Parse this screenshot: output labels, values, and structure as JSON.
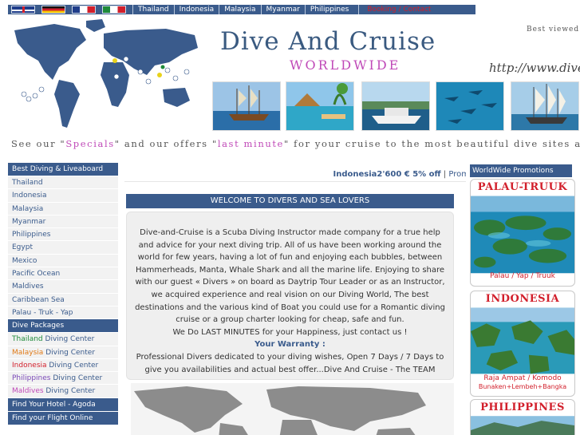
{
  "colors": {
    "nav": "#3a5b8c",
    "accent": "#c04ab8",
    "alert": "#d21f2b",
    "panel": "#efefef"
  },
  "topnav": {
    "flags": [
      "uk-flag-icon",
      "germany-flag-icon",
      "france-flag-icon",
      "italy-flag-icon"
    ],
    "links": [
      "Thailand",
      "Indonesia",
      "Malaysia",
      "Myanmar",
      "Philippines"
    ],
    "booking": "Booking / Contact"
  },
  "banner": {
    "title": "Dive And Cruise",
    "subtitle": "WORLDWIDE",
    "best_viewed": "Best viewed",
    "url": "http://www.dive-",
    "tagline_1": "See our \"",
    "tagline_specials": "Specials",
    "tagline_2": "\" and our offers \"",
    "tagline_last": "last minute",
    "tagline_3": "\" for your cruise to the most beautiful dive sites aro"
  },
  "sidebar": {
    "head1": "Best Diving & Liveaboard",
    "destinations": [
      "Thailand",
      "Indonesia",
      "Malaysia",
      "Myanmar",
      "Philippines",
      "Egypt",
      "Mexico",
      "Pacific Ocean",
      "Maldives",
      "Caribbean Sea",
      "Palau - Truk - Yap"
    ],
    "head2": "Dive Packages",
    "packages": [
      {
        "country": "Thailand",
        "rest": " Diving Center"
      },
      {
        "country": "Malaysia",
        "rest": " Diving Center"
      },
      {
        "country": "Indonesia",
        "rest": " Diving Center"
      },
      {
        "country": "Philippines",
        "rest": " Diving Center"
      },
      {
        "country": "Maldives",
        "rest": " Diving Center"
      }
    ],
    "head3": "Find Your Hotel - Agoda",
    "head4": "Find your Flight Online"
  },
  "ticker": {
    "text": "Indonesia2'600 € 5% off",
    "sep": " | ",
    "next": "Prom"
  },
  "main": {
    "welcome_title": "WELCOME TO DIVERS AND SEA LOVERS",
    "paragraph": "Dive-and-Cruise is a Scuba Diving Instructor made company for a true help and advice for your next diving trip. All of us have been working around the world for few years, having a lot of fun and enjoying each bubbles, between Hammerheads, Manta, Whale Shark and all the marine life. Enjoying to share with our guest « Divers » on board as Daytrip Tour Leader or as an Instructor, we acquired experience and real vision on our Diving World, The best destinations and the various kind of Boat you could use for a Romantic diving cruise or a group charter looking for cheap, safe and fun.",
    "last_minutes": "We Do LAST MINUTES for your Happiness, just contact us !",
    "warranty_title": "Your Warranty :",
    "warranty_text": "Professional Divers dedicated to your diving wishes, Open 7 Days / 7 Days to give you availabilities and actual best offer...Dive And Cruise - The TEAM"
  },
  "promos": {
    "head": "WorldWide Promotions",
    "palau_title": "PALAU-TRUUK",
    "palau_caption": "Palau / Yap / Truuk",
    "indonesia_title": "INDONESIA",
    "indonesia_caption": "Raja Ampat / Komodo",
    "indonesia_caption2": "Bunaken+Lembeh+Bangka",
    "philippines_title": "PHILIPPINES"
  }
}
